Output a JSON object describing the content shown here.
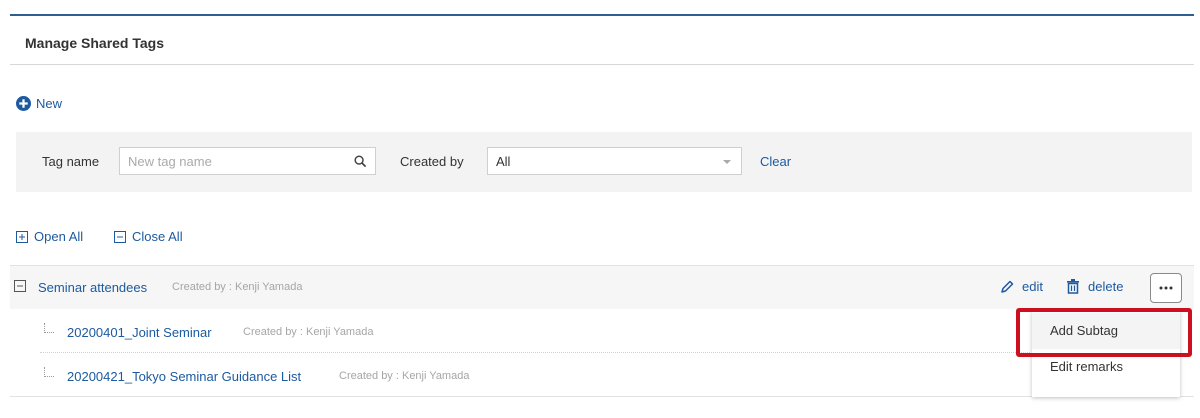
{
  "page": {
    "title": "Manage Shared Tags"
  },
  "toolbar": {
    "new_label": "New"
  },
  "filters": {
    "tag_name_label": "Tag name",
    "tag_name_placeholder": "New tag name",
    "tag_name_value": "",
    "created_by_label": "Created by",
    "created_by_value": "All",
    "clear_label": "Clear"
  },
  "tree_controls": {
    "open_all_label": "Open All",
    "close_all_label": "Close All"
  },
  "tags": [
    {
      "name": "Seminar attendees",
      "meta": "Created by : Kenji Yamada",
      "edit_label": "edit",
      "delete_label": "delete",
      "subtags": [
        {
          "name": "20200401_Joint Seminar",
          "meta": "Created by : Kenji Yamada"
        },
        {
          "name": "20200421_Tokyo Seminar Guidance List",
          "meta": "Created by : Kenji Yamada"
        }
      ]
    }
  ],
  "context_menu": {
    "items": [
      {
        "label": "Add Subtag"
      },
      {
        "label": "Edit remarks"
      }
    ]
  },
  "colors": {
    "accent": "#1d5aa0",
    "header_rule": "#2d5f93",
    "highlight": "#cc1020"
  },
  "icons": {
    "new": "plus-circle-icon",
    "search": "search-icon",
    "dropdown": "caret-down-icon",
    "open_all": "plus-square-icon",
    "close_all": "minus-square-icon",
    "tree_toggle": "minus-square-icon",
    "edit": "pencil-icon",
    "delete": "trash-icon",
    "more": "ellipsis-icon"
  }
}
